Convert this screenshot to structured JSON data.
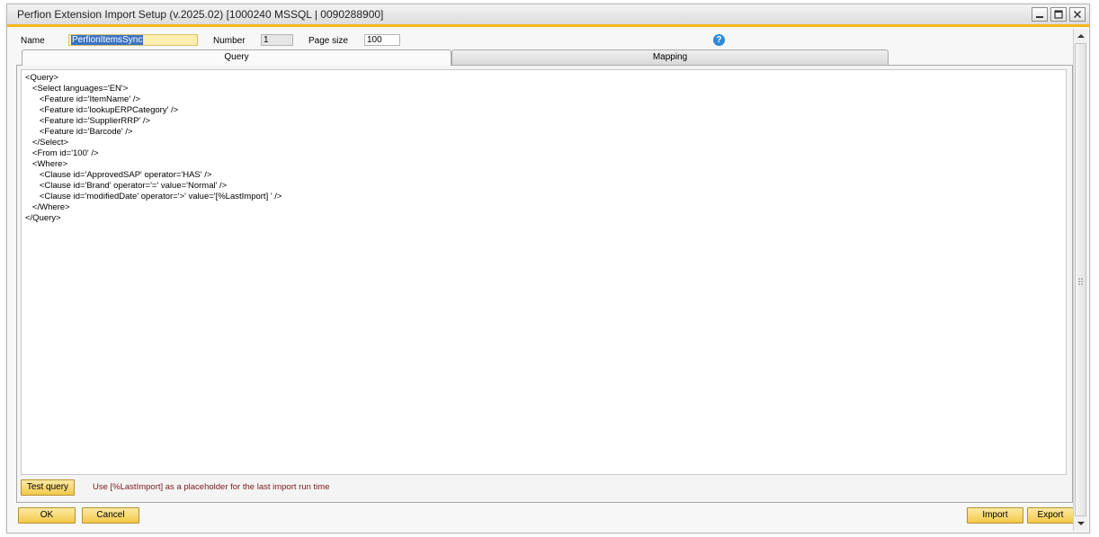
{
  "window": {
    "title": "Perfion Extension Import Setup (v.2025.02) [1000240 MSSQL | 0090288900]",
    "accent_color": "#f6b619",
    "controls": [
      "minimize-icon",
      "maximize-icon",
      "close-icon"
    ]
  },
  "form": {
    "name_label": "Name",
    "name_value": "PerfionItemsSync",
    "number_label": "Number",
    "number_value": "1",
    "page_size_label": "Page size",
    "page_size_value": "100",
    "help_icon": "question-circle-icon",
    "help_glyph": "?"
  },
  "tabs": [
    {
      "label": "Query",
      "active": true
    },
    {
      "label": "Mapping",
      "active": false
    }
  ],
  "query": {
    "text": "<Query>\n   <Select languages='EN'>\n      <Feature id='ItemName' />\n      <Feature id='lookupERPCategory' />\n      <Feature id='SupplierRRP' />\n      <Feature id='Barcode' />\n   </Select>\n   <From id='100' />\n   <Where>\n      <Clause id='ApprovedSAP' operator='HAS' />\n      <Clause id='Brand' operator='=' value='Normal' />\n      <Clause id='modifiedDate' operator='>' value='[%LastImport] ' />\n   </Where>\n</Query>",
    "test_button": "Test query",
    "hint": "Use [%LastImport] as a placeholder for the last import run time",
    "hint_color": "#7a1a1a"
  },
  "footer": {
    "ok": "OK",
    "cancel": "Cancel",
    "import": "Import",
    "export": "Export",
    "button_color": "#f3c94a"
  }
}
